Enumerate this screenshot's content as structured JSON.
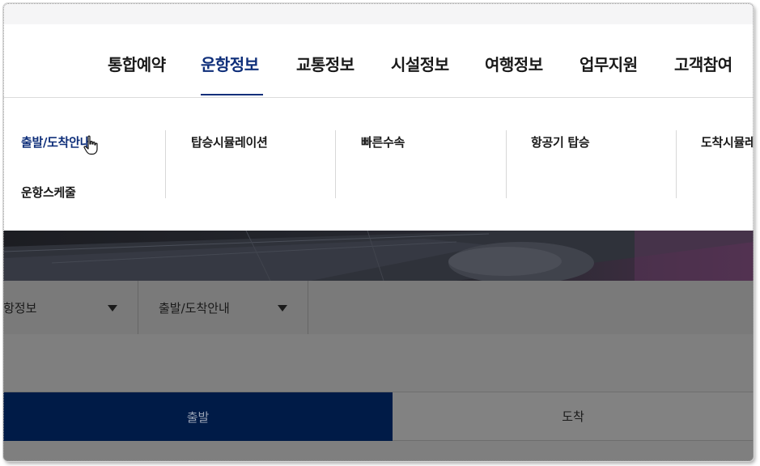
{
  "gnb": {
    "items": [
      {
        "label": "통합예약"
      },
      {
        "label": "운항정보",
        "active": true
      },
      {
        "label": "교통정보"
      },
      {
        "label": "시설정보"
      },
      {
        "label": "여행정보"
      },
      {
        "label": "업무지원"
      },
      {
        "label": "고객참여"
      }
    ]
  },
  "dropdown": {
    "columns": [
      {
        "links": [
          "출발/도착안내",
          "운항스케줄"
        ]
      },
      {
        "links": [
          "탑승시뮬레이션"
        ]
      },
      {
        "links": [
          "빠른수속"
        ]
      },
      {
        "links": [
          "항공기 탑승"
        ]
      },
      {
        "links": [
          "도착시뮬레이"
        ]
      }
    ]
  },
  "location": {
    "level1": "항정보",
    "level2": "출발/도착안내"
  },
  "tabs": {
    "departure": "출발",
    "arrival": "도착"
  },
  "colors": {
    "brand_navy": "#0f2f7a",
    "tab_active_bg": "#001b47",
    "overlay": "#7f7f7f"
  }
}
